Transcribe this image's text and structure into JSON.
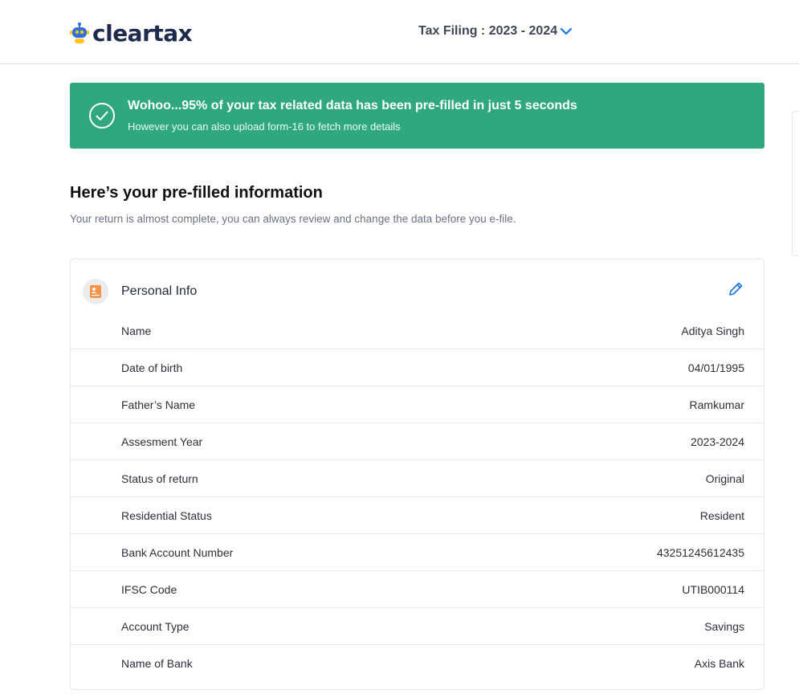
{
  "header": {
    "brand": "cleartax",
    "tax_filing_label": "Tax Filing : 2023 - 2024"
  },
  "banner": {
    "title": "Wohoo...95% of your tax related data has been pre-filled in just 5 seconds",
    "subtitle": "However you can also upload form-16 to fetch more details"
  },
  "section": {
    "heading": "Here’s your pre-filled information",
    "subheading": "Your return is almost complete, you can always review and change the data before you e-file."
  },
  "personal_info": {
    "title": "Personal Info",
    "rows": [
      {
        "label": "Name",
        "value": "Aditya Singh"
      },
      {
        "label": "Date of birth",
        "value": "04/01/1995"
      },
      {
        "label": "Father’s Name",
        "value": "Ramkumar"
      },
      {
        "label": "Assesment Year",
        "value": "2023-2024"
      },
      {
        "label": "Status of return",
        "value": "Original"
      },
      {
        "label": "Residential Status",
        "value": "Resident"
      },
      {
        "label": "Bank Account Number",
        "value": "43251245612435"
      },
      {
        "label": "IFSC Code",
        "value": "UTIB000114"
      },
      {
        "label": "Account Type",
        "value": "Savings"
      },
      {
        "label": "Name of Bank",
        "value": "Axis Bank"
      }
    ]
  },
  "colors": {
    "banner_green": "#30a87e",
    "brand_navy": "#1f2b4d",
    "accent_blue": "#1a73e8"
  },
  "icons": [
    "cleartax-logo-icon",
    "chevron-down-icon",
    "check-circle-icon",
    "contact-card-icon",
    "pencil-edit-icon"
  ]
}
